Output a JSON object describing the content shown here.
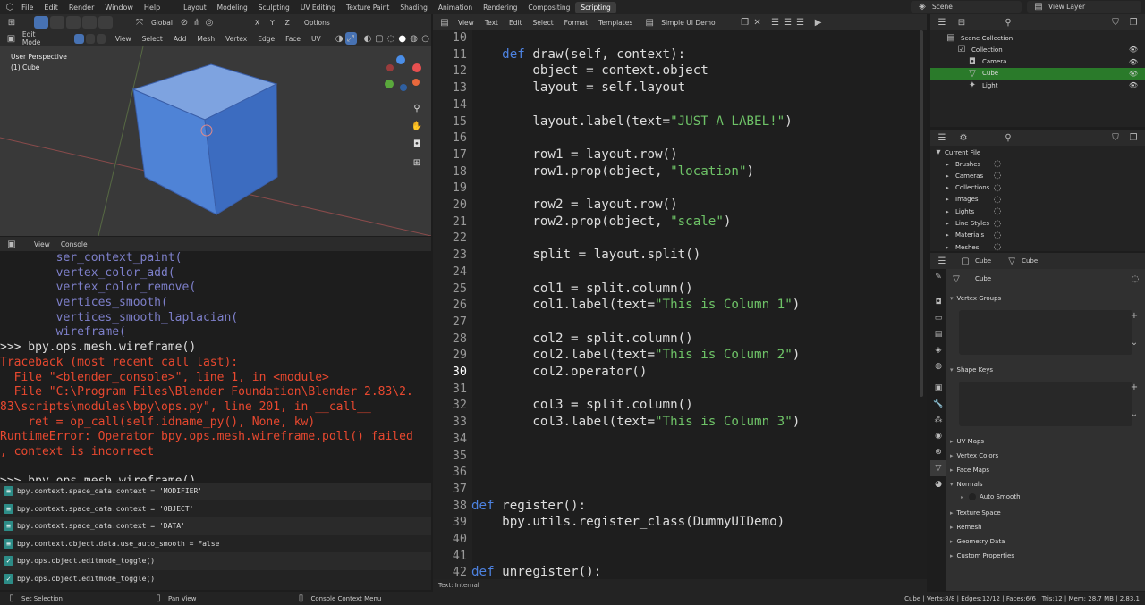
{
  "topbar": {
    "menu": [
      "File",
      "Edit",
      "Render",
      "Window",
      "Help"
    ],
    "workspaces": [
      "Layout",
      "Modeling",
      "Sculpting",
      "UV Editing",
      "Texture Paint",
      "Shading",
      "Animation",
      "Rendering",
      "Compositing",
      "Scripting"
    ],
    "active_workspace": "Scripting",
    "scene": "Scene",
    "view_layer": "View Layer"
  },
  "viewport_header": {
    "orientation": "Global",
    "axes": [
      "X",
      "Y",
      "Z"
    ],
    "options": "Options",
    "mode": "Edit Mode",
    "menus": [
      "View",
      "Select",
      "Add",
      "Mesh",
      "Vertex",
      "Edge",
      "Face",
      "UV"
    ]
  },
  "viewport": {
    "view_name": "User Perspective",
    "object_label": "(1) Cube",
    "gizmo_axes": [
      "X",
      "Y",
      "Z"
    ]
  },
  "console_header": {
    "menus": [
      "View",
      "Console"
    ]
  },
  "console": {
    "lines": [
      {
        "t": "        ser_context_paint(",
        "c": "ac"
      },
      {
        "t": "        vertex_color_add(",
        "c": "ac"
      },
      {
        "t": "        vertex_color_remove(",
        "c": "ac"
      },
      {
        "t": "        vertices_smooth(",
        "c": "ac"
      },
      {
        "t": "        vertices_smooth_laplacian(",
        "c": "ac"
      },
      {
        "t": "        wireframe(",
        "c": "ac"
      },
      {
        "t": ">>> bpy.ops.mesh.wireframe()",
        "c": "out"
      },
      {
        "t": "Traceback (most recent call last):",
        "c": "err"
      },
      {
        "t": "  File \"<blender_console>\", line 1, in <module>",
        "c": "err"
      },
      {
        "t": "  File \"C:\\Program Files\\Blender Foundation\\Blender 2.83\\2.",
        "c": "err"
      },
      {
        "t": "83\\scripts\\modules\\bpy\\ops.py\", line 201, in __call__",
        "c": "err"
      },
      {
        "t": "    ret = op_call(self.idname_py(), None, kw)",
        "c": "err"
      },
      {
        "t": "RuntimeError: Operator bpy.ops.mesh.wireframe.poll() failed",
        "c": "err"
      },
      {
        "t": ", context is incorrect",
        "c": "err"
      },
      {
        "t": "",
        "c": "out"
      },
      {
        "t": ">>> bpy.ops.mesh.wireframe()",
        "c": "out"
      }
    ]
  },
  "info_log": [
    "bpy.context.space_data.context = 'MODIFIER'",
    "bpy.context.space_data.context = 'OBJECT'",
    "bpy.context.space_data.context = 'DATA'",
    "bpy.context.object.data.use_auto_smooth = False",
    "bpy.ops.object.editmode_toggle()",
    "bpy.ops.object.editmode_toggle()"
  ],
  "text_editor": {
    "menus": [
      "View",
      "Text",
      "Edit",
      "Select",
      "Format",
      "Templates"
    ],
    "file_name": "Simple UI Demo",
    "footer": "Text: Internal",
    "current_line": 30,
    "lines": [
      {
        "n": "10",
        "p": []
      },
      {
        "n": "11",
        "p": [
          [
            "    ",
            ""
          ],
          [
            "def ",
            "kw"
          ],
          [
            "draw(self, context):",
            ""
          ]
        ]
      },
      {
        "n": "12",
        "p": [
          [
            "        object = context.object",
            ""
          ]
        ]
      },
      {
        "n": "13",
        "p": [
          [
            "        layout = self.layout",
            ""
          ]
        ]
      },
      {
        "n": "14",
        "p": []
      },
      {
        "n": "15",
        "p": [
          [
            "        layout.label(text=",
            ""
          ],
          [
            "\"JUST A LABEL!\"",
            "st"
          ],
          [
            ")",
            ""
          ]
        ]
      },
      {
        "n": "16",
        "p": []
      },
      {
        "n": "17",
        "p": [
          [
            "        row1 = layout.row()",
            ""
          ]
        ]
      },
      {
        "n": "18",
        "p": [
          [
            "        row1.prop(object, ",
            ""
          ],
          [
            "\"location\"",
            "st"
          ],
          [
            ")",
            ""
          ]
        ]
      },
      {
        "n": "19",
        "p": []
      },
      {
        "n": "20",
        "p": [
          [
            "        row2 = layout.row()",
            ""
          ]
        ]
      },
      {
        "n": "21",
        "p": [
          [
            "        row2.prop(object, ",
            ""
          ],
          [
            "\"scale\"",
            "st"
          ],
          [
            ")",
            ""
          ]
        ]
      },
      {
        "n": "22",
        "p": []
      },
      {
        "n": "23",
        "p": [
          [
            "        split = layout.split()",
            ""
          ]
        ]
      },
      {
        "n": "24",
        "p": []
      },
      {
        "n": "25",
        "p": [
          [
            "        col1 = split.column()",
            ""
          ]
        ]
      },
      {
        "n": "26",
        "p": [
          [
            "        col1.label(text=",
            ""
          ],
          [
            "\"This is Column 1\"",
            "st"
          ],
          [
            ")",
            ""
          ]
        ]
      },
      {
        "n": "27",
        "p": []
      },
      {
        "n": "28",
        "p": [
          [
            "        col2 = split.column()",
            ""
          ]
        ]
      },
      {
        "n": "29",
        "p": [
          [
            "        col2.label(text=",
            ""
          ],
          [
            "\"This is Column 2\"",
            "st"
          ],
          [
            ")",
            ""
          ]
        ]
      },
      {
        "n": "30",
        "p": [
          [
            "        col2.operator()",
            ""
          ]
        ]
      },
      {
        "n": "31",
        "p": []
      },
      {
        "n": "32",
        "p": [
          [
            "        col3 = split.column()",
            ""
          ]
        ]
      },
      {
        "n": "33",
        "p": [
          [
            "        col3.label(text=",
            ""
          ],
          [
            "\"This is Column 3\"",
            "st"
          ],
          [
            ")",
            ""
          ]
        ]
      },
      {
        "n": "34",
        "p": []
      },
      {
        "n": "35",
        "p": []
      },
      {
        "n": "36",
        "p": []
      },
      {
        "n": "37",
        "p": []
      },
      {
        "n": "38",
        "p": [
          [
            "def ",
            "kw"
          ],
          [
            "register():",
            ""
          ]
        ]
      },
      {
        "n": "39",
        "p": [
          [
            "    bpy.utils.register_class(DummyUIDemo)",
            ""
          ]
        ]
      },
      {
        "n": "40",
        "p": []
      },
      {
        "n": "41",
        "p": []
      },
      {
        "n": "42",
        "p": [
          [
            "def ",
            "kw"
          ],
          [
            "unregister():",
            ""
          ]
        ]
      }
    ]
  },
  "outliner": {
    "rows": [
      {
        "label": "Scene Collection",
        "indent": 0,
        "sel": false,
        "eye": false
      },
      {
        "label": "Collection",
        "indent": 1,
        "sel": false,
        "eye": true
      },
      {
        "label": "Camera",
        "indent": 2,
        "sel": false,
        "eye": true
      },
      {
        "label": "Cube",
        "indent": 2,
        "sel": true,
        "eye": true
      },
      {
        "label": "Light",
        "indent": 2,
        "sel": false,
        "eye": true
      }
    ]
  },
  "data_browser": {
    "title": "Current File",
    "rows": [
      "Brushes",
      "Cameras",
      "Collections",
      "Images",
      "Lights",
      "Line Styles",
      "Materials",
      "Meshes"
    ]
  },
  "properties": {
    "breadcrumb": [
      "Cube",
      "Cube"
    ],
    "mesh_name": "Cube",
    "sections": [
      "Vertex Groups",
      "Shape Keys",
      "UV Maps",
      "Vertex Colors",
      "Face Maps",
      "Normals",
      "Texture Space",
      "Remesh",
      "Geometry Data",
      "Custom Properties"
    ],
    "auto_smooth": "Auto Smooth"
  },
  "status_bar": {
    "left": [
      "Set Selection",
      "Pan View",
      "Console Context Menu"
    ],
    "stats": "Cube | Verts:8/8 | Edges:12/12 | Faces:6/6 | Tris:12 | Mem: 28.7 MB | 2.83.1"
  },
  "colors": {
    "accent": "#4772b3",
    "selected_row": "#2a7a2a",
    "error": "#e8482f",
    "keyword": "#4d82e0",
    "string": "#6ec267"
  }
}
